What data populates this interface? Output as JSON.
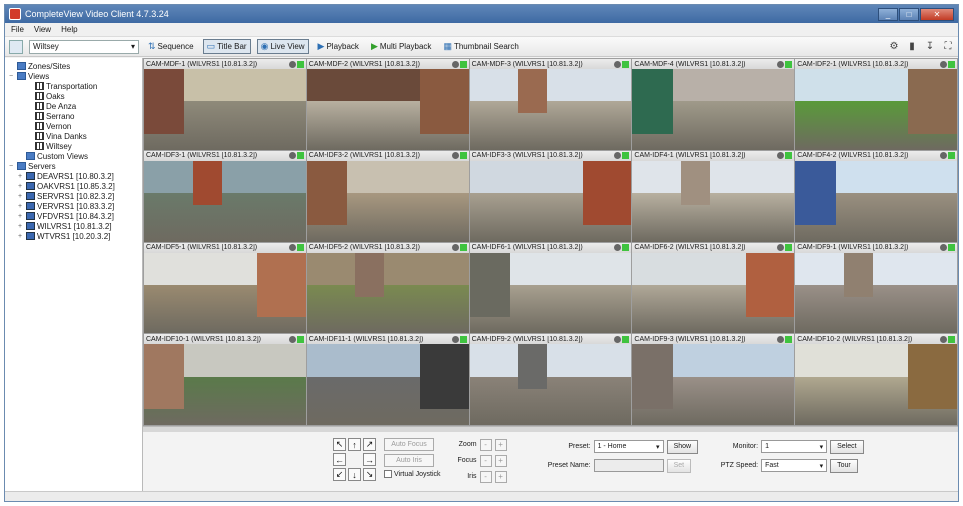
{
  "window": {
    "title": "CompleteView Video Client 4.7.3.24"
  },
  "menu": [
    "File",
    "View",
    "Help"
  ],
  "toolbar": {
    "site": "Wiltsey",
    "sequence": "Sequence",
    "title_bar": "Title Bar",
    "live_view": "Live View",
    "playback": "Playback",
    "multi_playback": "Multi Playback",
    "thumbnail_search": "Thumbnail Search"
  },
  "tree": [
    {
      "label": "Zones/Sites",
      "icon": "folder-icon",
      "level": 0,
      "exp": ""
    },
    {
      "label": "Views",
      "icon": "folder-icon",
      "level": 0,
      "exp": "−"
    },
    {
      "label": "Transportation",
      "icon": "grid-icon",
      "level": 2,
      "exp": ""
    },
    {
      "label": "Oaks",
      "icon": "grid-icon",
      "level": 2,
      "exp": ""
    },
    {
      "label": "De Anza",
      "icon": "grid-icon",
      "level": 2,
      "exp": ""
    },
    {
      "label": "Serrano",
      "icon": "grid-icon",
      "level": 2,
      "exp": ""
    },
    {
      "label": "Vernon",
      "icon": "grid-icon",
      "level": 2,
      "exp": ""
    },
    {
      "label": "Vina Danks",
      "icon": "grid-icon",
      "level": 2,
      "exp": ""
    },
    {
      "label": "Wiltsey",
      "icon": "grid-icon",
      "level": 2,
      "exp": ""
    },
    {
      "label": "Custom Views",
      "icon": "folder-icon",
      "level": 1,
      "exp": ""
    },
    {
      "label": "Servers",
      "icon": "folder-icon",
      "level": 0,
      "exp": "−"
    },
    {
      "label": "DEAVRS1 [10.80.3.2]",
      "icon": "server-icon",
      "level": 1,
      "exp": "+"
    },
    {
      "label": "OAKVRS1 [10.85.3.2]",
      "icon": "server-icon",
      "level": 1,
      "exp": "+"
    },
    {
      "label": "SERVRS1 [10.82.3.2]",
      "icon": "server-icon",
      "level": 1,
      "exp": "+"
    },
    {
      "label": "VERVRS1 [10.83.3.2]",
      "icon": "server-icon",
      "level": 1,
      "exp": "+"
    },
    {
      "label": "VFDVRS1 [10.84.3.2]",
      "icon": "server-icon",
      "level": 1,
      "exp": "+"
    },
    {
      "label": "WILVRS1 [10.81.3.2]",
      "icon": "server-icon",
      "level": 1,
      "exp": "+"
    },
    {
      "label": "WTVRS1 [10.20.3.2]",
      "icon": "server-icon",
      "level": 1,
      "exp": "+"
    }
  ],
  "cameras": [
    {
      "label": "CAM-MDF-1 (WILVRS1 [10.81.3.2])",
      "sky": "#c8c0a8",
      "ground": "#8f8a7a",
      "wall": "#7a4a3a"
    },
    {
      "label": "CAM-MDF-2 (WILVRS1 [10.81.3.2])",
      "sky": "#6a4a3a",
      "ground": "#b8b0a0",
      "wall": "#8a5a40"
    },
    {
      "label": "CAM-MDF-3 (WILVRS1 [10.81.3.2])",
      "sky": "#d8e0e8",
      "ground": "#b0a898",
      "wall": "#9a6a50"
    },
    {
      "label": "CAM-MDF-4 (WILVRS1 [10.81.3.2])",
      "sky": "#b8b0a8",
      "ground": "#a09a8a",
      "wall": "#2e6a50"
    },
    {
      "label": "CAM-IDF2-1 (WILVRS1 [10.81.3.2])",
      "sky": "#cfe0ea",
      "ground": "#5a9a3a",
      "wall": "#8a6a50"
    },
    {
      "label": "CAM-IDF3-1 (WILVRS1 [10.81.3.2])",
      "sky": "#8aa0a8",
      "ground": "#6a7a6a",
      "wall": "#a04a30"
    },
    {
      "label": "CAM-IDF3-2 (WILVRS1 [10.81.3.2])",
      "sky": "#c8c0b0",
      "ground": "#a89880",
      "wall": "#8a5a40"
    },
    {
      "label": "CAM-IDF3-3 (WILVRS1 [10.81.3.2])",
      "sky": "#d0d8e0",
      "ground": "#a8a090",
      "wall": "#a04a30"
    },
    {
      "label": "CAM-IDF4-1 (WILVRS1 [10.81.3.2])",
      "sky": "#dfe4ea",
      "ground": "#b8b0a0",
      "wall": "#a09080"
    },
    {
      "label": "CAM-IDF4-2 (WILVRS1 [10.81.3.2])",
      "sky": "#cfe0ee",
      "ground": "#9a9080",
      "wall": "#3a5a9a"
    },
    {
      "label": "CAM-IDF5-1 (WILVRS1 [10.81.3.2])",
      "sky": "#e0e0dc",
      "ground": "#9a8a70",
      "wall": "#b07050"
    },
    {
      "label": "CAM-IDF5-2 (WILVRS1 [10.81.3.2])",
      "sky": "#9a8a70",
      "ground": "#7a8a50",
      "wall": "#8a7060"
    },
    {
      "label": "CAM-IDF6-1 (WILVRS1 [10.81.3.2])",
      "sky": "#dfe4e8",
      "ground": "#a8a090",
      "wall": "#6a6a60"
    },
    {
      "label": "CAM-IDF6-2 (WILVRS1 [10.81.3.2])",
      "sky": "#d8dde0",
      "ground": "#b0a898",
      "wall": "#b06040"
    },
    {
      "label": "CAM-IDF9-1 (WILVRS1 [10.81.3.2])",
      "sky": "#dfe6ee",
      "ground": "#9a9088",
      "wall": "#908070"
    },
    {
      "label": "CAM-IDF10-1 (WILVRS1 [10.81.3.2])",
      "sky": "#c8c8c0",
      "ground": "#5a7a4a",
      "wall": "#a07860"
    },
    {
      "label": "CAM-IDF11-1 (WILVRS1 [10.81.3.2])",
      "sky": "#aabccc",
      "ground": "#6a6a6a",
      "wall": "#3a3a3a"
    },
    {
      "label": "CAM-IDF9-2 (WILVRS1 [10.81.3.2])",
      "sky": "#d8e0e8",
      "ground": "#8a8278",
      "wall": "#6a6a68"
    },
    {
      "label": "CAM-IDF9-3 (WILVRS1 [10.81.3.2])",
      "sky": "#bfd0e0",
      "ground": "#9a9088",
      "wall": "#7a7068"
    },
    {
      "label": "CAM-IDF10-2 (WILVRS1 [10.81.3.2])",
      "sky": "#e0e0d8",
      "ground": "#b0a890",
      "wall": "#8a6a40"
    }
  ],
  "ptz": {
    "auto_focus": "Auto Focus",
    "auto_iris": "Auto Iris",
    "virtual_joystick": "Virtual Joystick",
    "zoom": "Zoom",
    "focus": "Focus",
    "iris": "Iris",
    "plus": "+",
    "minus": "-",
    "preset_label": "Preset:",
    "preset_value": "1 - Home",
    "show": "Show",
    "preset_name_label": "Preset Name:",
    "preset_name_value": "",
    "set": "Set",
    "monitor_label": "Monitor:",
    "monitor_value": "1",
    "select": "Select",
    "ptz_speed_label": "PTZ Speed:",
    "ptz_speed_value": "Fast",
    "tour": "Tour"
  }
}
